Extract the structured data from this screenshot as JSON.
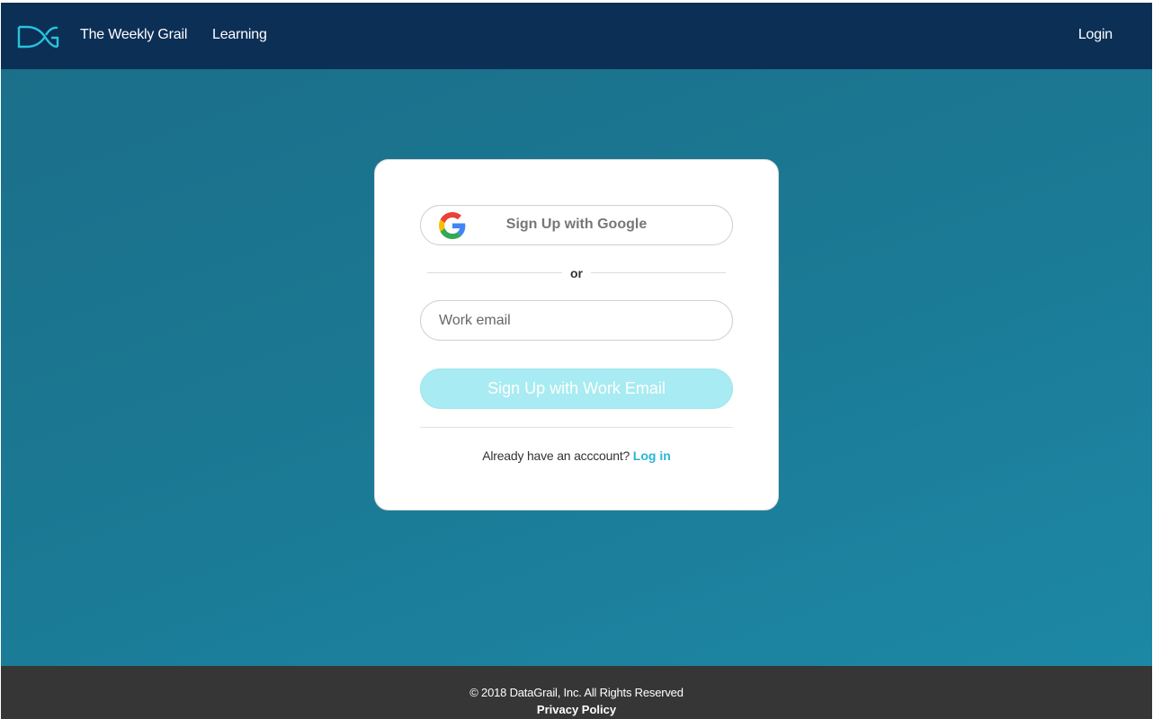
{
  "navbar": {
    "logo_icon": "datagrail-logo-icon",
    "links": {
      "weekly": "The Weekly Grail",
      "learning": "Learning"
    },
    "login": "Login",
    "background": "#0c2f56"
  },
  "signup": {
    "google_icon": "google-icon",
    "google_button": "Sign Up with Google",
    "divider_text": "or",
    "email_placeholder": "Work email",
    "email_value": "",
    "email_button": "Sign Up with Work Email",
    "login_prompt": "Already have an acccount?",
    "login_link": "Log in"
  },
  "footer": {
    "copyright": "© 2018 DataGrail, Inc. All Rights Reserved",
    "privacy": "Privacy Policy"
  },
  "colors": {
    "accent": "#29b6d4",
    "hero": "#1b7893",
    "email_button_bg": "#a8ebf2",
    "footer_bg": "#363636"
  }
}
